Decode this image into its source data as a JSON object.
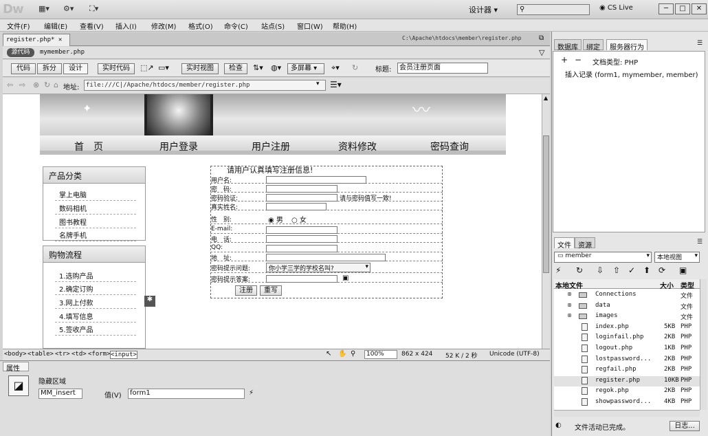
{
  "app": {
    "logo": "Dw",
    "workspace": "设计器",
    "cs_live": "CS Live",
    "search_placeholder": ""
  },
  "menu": [
    "文件(F)",
    "编辑(E)",
    "查看(V)",
    "插入(I)",
    "修改(M)",
    "格式(O)",
    "命令(C)",
    "站点(S)",
    "窗口(W)",
    "帮助(H)"
  ],
  "document": {
    "tab": "register.php*",
    "path": "C:\\Apache\\htdocs\\member\\register.php",
    "source_pill": "源代码",
    "related_file": "mymember.php"
  },
  "toolbar": {
    "code": "代码",
    "split": "拆分",
    "design": "设计",
    "live_code": "实时代码",
    "live_view": "实时视图",
    "inspect": "检查",
    "multiscreen": "多屏幕",
    "title_label": "标题:",
    "title_value": "会员注册页面"
  },
  "address": {
    "label": "地址:",
    "value": "file:///C|/Apache/htdocs/member/register.php"
  },
  "page": {
    "nav": [
      "首　页",
      "用户登录",
      "用户注册",
      "资料修改",
      "密码查询"
    ],
    "side1": {
      "title": "产品分类",
      "items": [
        "掌上电脑",
        "数码相机",
        "图书教程",
        "名牌手机"
      ]
    },
    "side2": {
      "title": "购物流程",
      "items": [
        "1.选购产品",
        "2.确定订购",
        "3.网上付款",
        "4.填写信息",
        "5.签收产品"
      ]
    },
    "form": {
      "heading": "请用户认真填写注册信息!",
      "labels": [
        "用户名:",
        "密　码:",
        "密码验证:",
        "真实姓名:",
        "性　别:",
        "E-mail:",
        "电　话:",
        "QQ:",
        "地　址:",
        "密码提示问题:",
        "密码提示答案:"
      ],
      "verify_hint": "请与密码值写一致!",
      "gender_male": "男",
      "gender_female": "女",
      "question_value": "你小学三学的学校名叫?",
      "submit": "注册",
      "reset": "重写"
    }
  },
  "status": {
    "tags": [
      "<body>",
      "<table>",
      "<tr>",
      "<td>",
      "<form>",
      "<input>"
    ],
    "zoom": "100%",
    "size": "862 x 424",
    "weight": "52 K / 2 秒",
    "encoding": "Unicode (UTF-8)"
  },
  "properties": {
    "panel": "属性",
    "label": "隐藏区域",
    "name": "MM_insert",
    "value_label": "值(V)",
    "value": "form1"
  },
  "server_panel": {
    "tabs": [
      "数据库",
      "绑定",
      "服务器行为"
    ],
    "doc_type": "文档类型: PHP",
    "item": "插入记录 (form1, mymember, member)"
  },
  "files_panel": {
    "tabs": [
      "文件",
      "资源"
    ],
    "site": "member",
    "view": "本地视图",
    "headers": [
      "本地文件",
      "大小",
      "类型"
    ],
    "rows": [
      {
        "name": "Connections",
        "size": "",
        "type": "文件",
        "folder": true
      },
      {
        "name": "data",
        "size": "",
        "type": "文件",
        "folder": true
      },
      {
        "name": "images",
        "size": "",
        "type": "文件",
        "folder": true
      },
      {
        "name": "index.php",
        "size": "5KB",
        "type": "PHP",
        "folder": false
      },
      {
        "name": "loginfail.php",
        "size": "2KB",
        "type": "PHP",
        "folder": false
      },
      {
        "name": "logout.php",
        "size": "1KB",
        "type": "PHP",
        "folder": false
      },
      {
        "name": "lostpassword...",
        "size": "2KB",
        "type": "PHP",
        "folder": false
      },
      {
        "name": "regfail.php",
        "size": "2KB",
        "type": "PHP",
        "folder": false
      },
      {
        "name": "register.php",
        "size": "10KB",
        "type": "PHP",
        "folder": false
      },
      {
        "name": "regok.php",
        "size": "2KB",
        "type": "PHP",
        "folder": false
      },
      {
        "name": "showpassword...",
        "size": "4KB",
        "type": "PHP",
        "folder": false
      }
    ],
    "status": "文件活动已完成。",
    "log": "日志..."
  }
}
